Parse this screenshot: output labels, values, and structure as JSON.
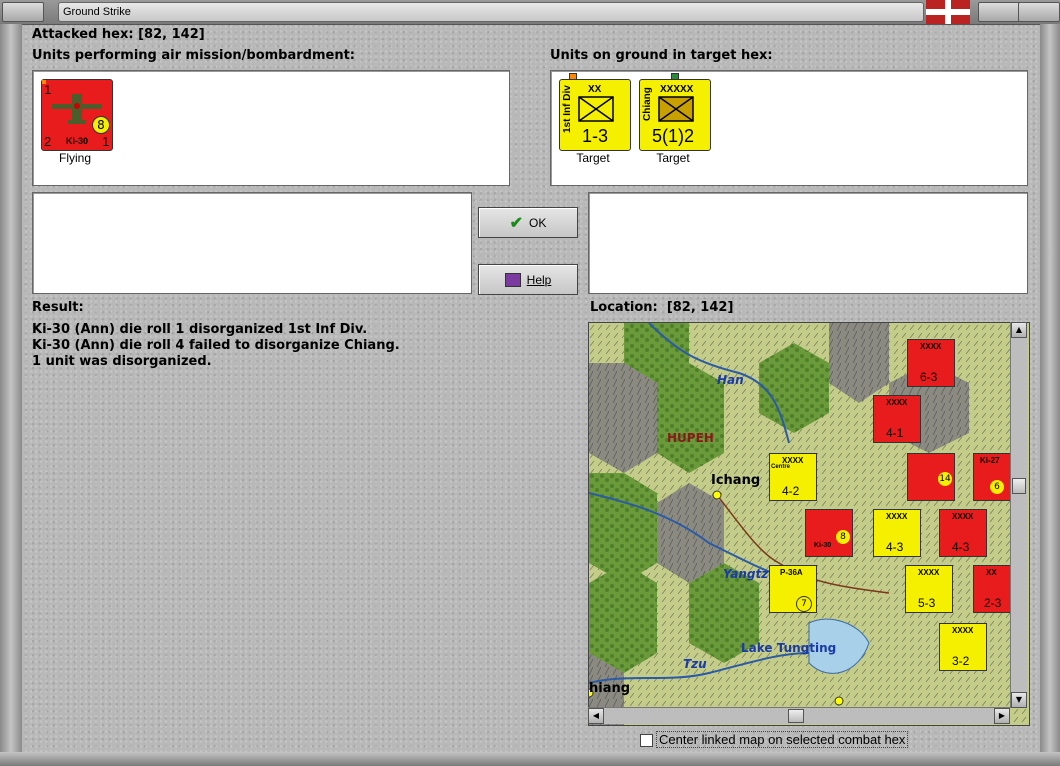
{
  "window": {
    "title": "Ground Strike"
  },
  "header": {
    "attacked_hex_label": "Attacked hex:",
    "attacked_hex": "[82, 142]"
  },
  "air_units": {
    "heading": "Units performing air mission/bombardment:",
    "items": [
      {
        "name": "Ki-30",
        "top_left": "1",
        "bottom_left": "2",
        "bottom_right": "1",
        "circle": "8",
        "status": "Flying",
        "color": "#e81c1c"
      }
    ]
  },
  "ground_units": {
    "heading": "Units on ground in target hex:",
    "items": [
      {
        "name": "1st Inf Div",
        "size": "XX",
        "strength": "1-3",
        "status": "Target",
        "color": "#f5f000"
      },
      {
        "name": "Chiang",
        "size": "XXXXX",
        "strength": "5(1)2",
        "status": "Target",
        "color": "#f5f000"
      }
    ]
  },
  "buttons": {
    "ok": "OK",
    "help": "Help"
  },
  "result": {
    "heading": "Result:",
    "lines": [
      "Ki-30 (Ann) die roll 1 disorganized 1st Inf Div.",
      "Ki-30 (Ann) die roll 4 failed to disorganize Chiang.",
      "1 unit was disorganized."
    ]
  },
  "location": {
    "label": "Location:",
    "hex": "[82, 142]"
  },
  "map": {
    "labels": [
      "Han",
      "HUPEH",
      "Ichang",
      "Yangtz",
      "Lake Tungting",
      "Tzu",
      "hiang"
    ],
    "counters": [
      {
        "side": "red",
        "name": "",
        "size": "XXXX",
        "strength": "6-3"
      },
      {
        "side": "red",
        "name": "",
        "size": "XXXX",
        "strength": "4-1"
      },
      {
        "side": "yellow",
        "name": "Centre",
        "size": "XXXX",
        "strength": "4-2"
      },
      {
        "side": "red",
        "name": "",
        "size": "",
        "strength": "14"
      },
      {
        "side": "red",
        "name": "Ki-27",
        "size": "",
        "strength": "6"
      },
      {
        "side": "red",
        "name": "Ki-30",
        "size": "",
        "strength": "8"
      },
      {
        "side": "yellow",
        "name": "",
        "size": "XXXX",
        "strength": "4-3"
      },
      {
        "side": "red",
        "name": "",
        "size": "XXXX",
        "strength": "4-3"
      },
      {
        "side": "yellow",
        "name": "P-36A",
        "size": "",
        "strength": "7"
      },
      {
        "side": "yellow",
        "name": "",
        "size": "XXXX",
        "strength": "5-3"
      },
      {
        "side": "red",
        "name": "",
        "size": "XX",
        "strength": "2-3"
      },
      {
        "side": "yellow",
        "name": "",
        "size": "XXXX",
        "strength": "3-2"
      }
    ]
  },
  "footer": {
    "checkbox_label": "Center linked map on selected combat hex",
    "checkbox_checked": false
  },
  "colors": {
    "axis_red": "#e81c1c",
    "allied_yellow": "#f5f000",
    "panel_bg": "#b8b8b8"
  }
}
